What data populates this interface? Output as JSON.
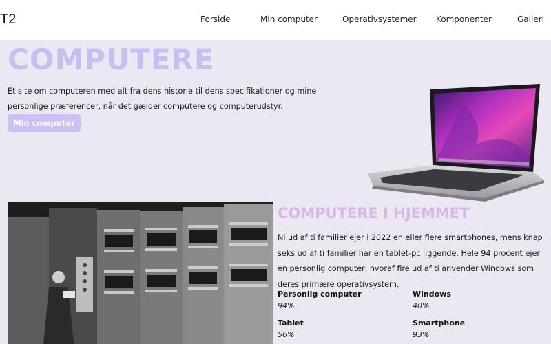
{
  "header": {
    "logo": "T2",
    "nav": [
      "Forside",
      "Min computer",
      "Operativsystemer",
      "Komponenter",
      "Galleri"
    ]
  },
  "hero": {
    "title": "COMPUTERE",
    "text": "Et site om computeren med alt fra dens historie til dens specifikationer og mine personlige præferencer, når det gælder computere og computerudstyr.",
    "button": "Min computer"
  },
  "section": {
    "title": "COMPUTERE I HJEMMET",
    "text": "Ni ud af ti familier ejer i 2022 en eller flere smartphones, mens knap seks ud af ti familier har en tablet-pc liggende. Hele 94 procent ejer en personlig computer, hvoraf fire ud af ti anvender Windows som deres primære operativsystem.",
    "stats": [
      {
        "label": "Personlig computer",
        "value": "94%"
      },
      {
        "label": "Windows",
        "value": "40%"
      },
      {
        "label": "Tablet",
        "value": "56%"
      },
      {
        "label": "Smartphone",
        "value": "93%"
      }
    ]
  },
  "colors": {
    "accent": "#c7bff0",
    "button": "#cdbff5",
    "section_title": "#d6b7e6",
    "background": "#ebe8f2"
  }
}
